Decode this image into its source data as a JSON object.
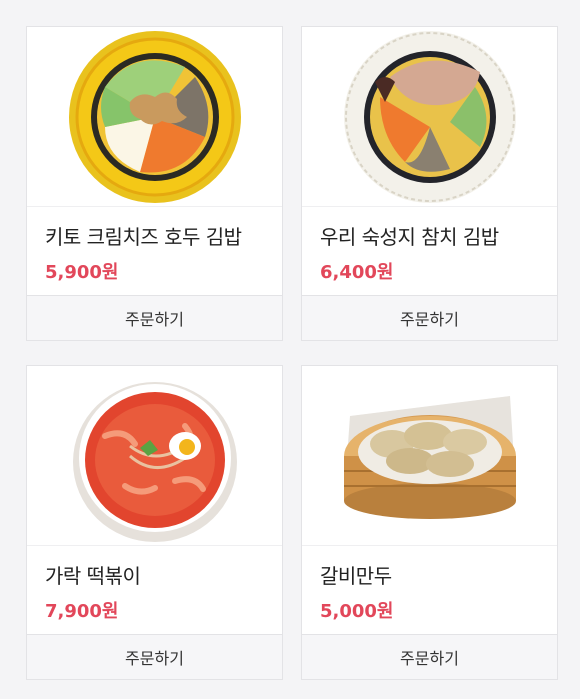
{
  "products": [
    {
      "name": "키토 크림치즈 호두 김밥",
      "price": "5,900원",
      "order_label": "주문하기",
      "image_icon": "kimbap-walnut-image"
    },
    {
      "name": "우리 숙성지 참치 김밥",
      "price": "6,400원",
      "order_label": "주문하기",
      "image_icon": "kimbap-tuna-image"
    },
    {
      "name": "가락 떡볶이",
      "price": "7,900원",
      "order_label": "주문하기",
      "image_icon": "tteokbokki-image"
    },
    {
      "name": "갈비만두",
      "price": "5,000원",
      "order_label": "주문하기",
      "image_icon": "dumpling-image"
    }
  ],
  "colors": {
    "price": "#e2475a",
    "button_bg": "#f6f6f8",
    "page_bg": "#f4f4f6"
  }
}
